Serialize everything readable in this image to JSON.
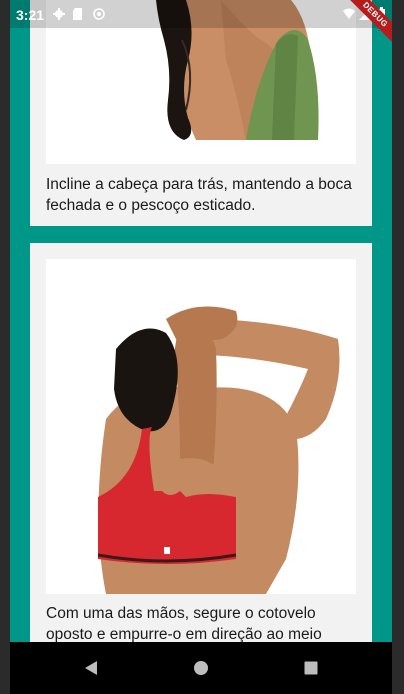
{
  "status_bar": {
    "time": "3:21",
    "icons": [
      "gear-icon",
      "sd-card-icon",
      "sync-icon",
      "wifi-icon",
      "signal-icon",
      "battery-icon"
    ],
    "debug_label": "DEBUG"
  },
  "colors": {
    "background": "#009688",
    "card": "#f2f2f2",
    "debug_ribbon": "#b71c1c",
    "nav_bar": "#000000"
  },
  "exercises": [
    {
      "image": "neck-stretch-photo",
      "caption": "Incline a cabeça para trás, mantendo a boca fechada e o pescoço esticado."
    },
    {
      "image": "triceps-stretch-photo",
      "caption": "Com uma das mãos, segure o cotovelo oposto e empurre-o em direção ao meio"
    }
  ],
  "nav_bar": {
    "buttons": [
      "back-icon",
      "home-icon",
      "recents-icon"
    ]
  }
}
